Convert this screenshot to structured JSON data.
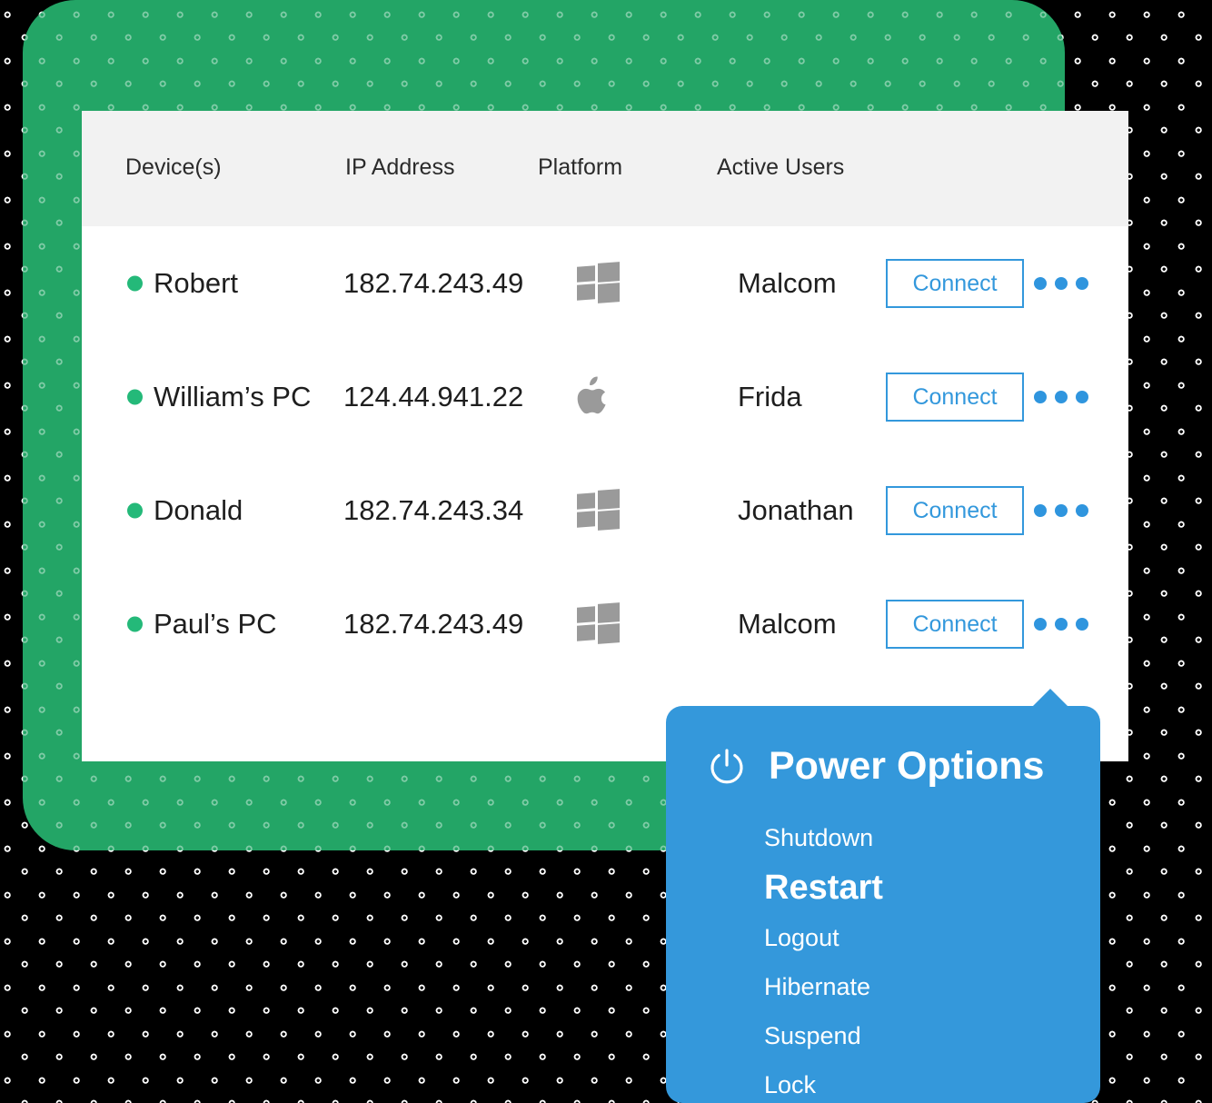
{
  "theme": {
    "background": "#000000",
    "panel_green": "#23a566",
    "card_white": "#ffffff",
    "header_grey": "#f2f2f2",
    "accent_blue": "#3498db",
    "status_green": "#24b979",
    "platform_grey": "#9a9a9a"
  },
  "table": {
    "columns": [
      {
        "label": "Device(s)"
      },
      {
        "label": "IP Address"
      },
      {
        "label": "Platform"
      },
      {
        "label": "Active Users"
      }
    ],
    "rows": [
      {
        "status": "online",
        "device": "Robert",
        "ip": "182.74.243.49",
        "platform": "windows",
        "platform_icon": "windows-icon",
        "active_user": "Malcom",
        "connect_label": "Connect",
        "more_icon": "more-options-icon"
      },
      {
        "status": "online",
        "device": "William’s PC",
        "ip": "124.44.941.22",
        "platform": "apple",
        "platform_icon": "apple-icon",
        "active_user": "Frida",
        "connect_label": "Connect",
        "more_icon": "more-options-icon"
      },
      {
        "status": "online",
        "device": "Donald",
        "ip": "182.74.243.34",
        "platform": "windows",
        "platform_icon": "windows-icon",
        "active_user": "Jonathan",
        "connect_label": "Connect",
        "more_icon": "more-options-icon"
      },
      {
        "status": "online",
        "device": "Paul’s PC",
        "ip": "182.74.243.49",
        "platform": "windows",
        "platform_icon": "windows-icon",
        "active_user": "Malcom",
        "connect_label": "Connect",
        "more_icon": "more-options-icon"
      }
    ]
  },
  "power_options": {
    "icon": "power-icon",
    "title": "Power Options",
    "selected": "Restart",
    "items": [
      {
        "label": "Shutdown",
        "selected": false
      },
      {
        "label": "Restart",
        "selected": true
      },
      {
        "label": "Logout",
        "selected": false
      },
      {
        "label": "Hibernate",
        "selected": false
      },
      {
        "label": "Suspend",
        "selected": false
      },
      {
        "label": "Lock",
        "selected": false
      }
    ]
  }
}
